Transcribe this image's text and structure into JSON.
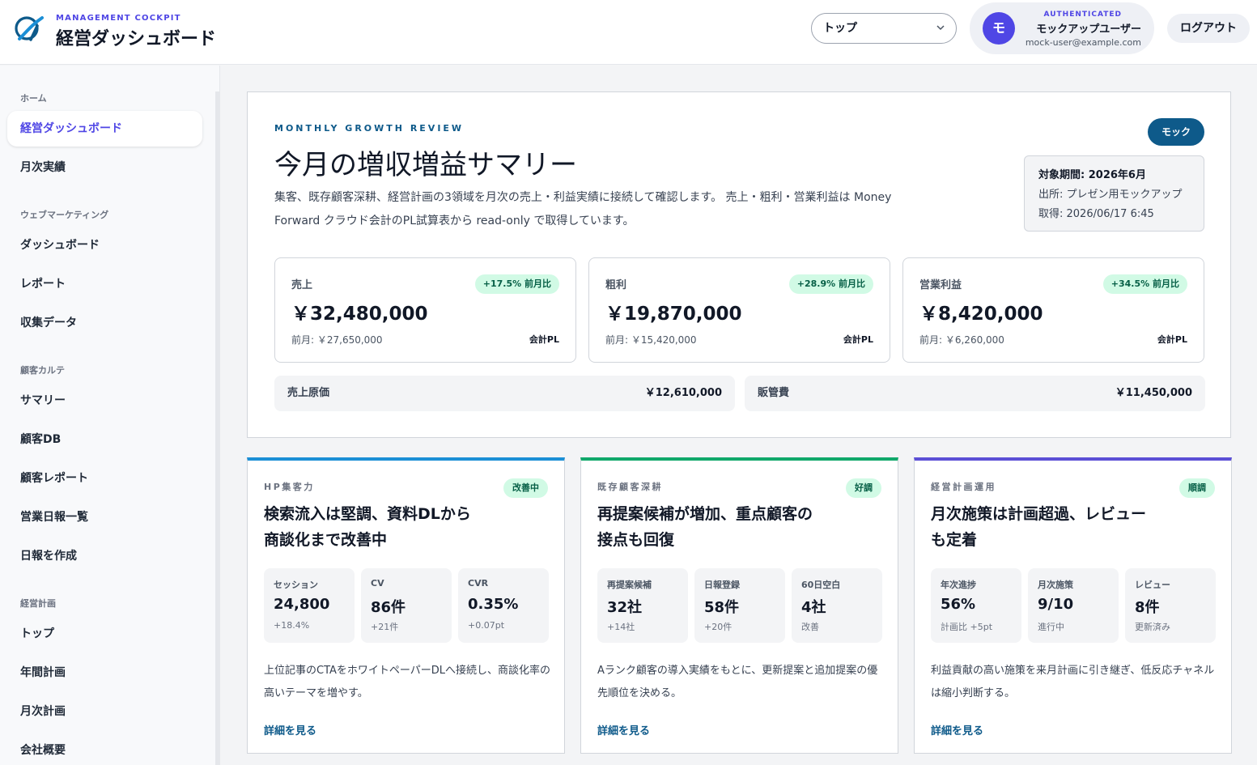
{
  "header": {
    "brand_sub": "MANAGEMENT COCKPIT",
    "brand_title": "経営ダッシュボード",
    "page_select": {
      "value": "トップ"
    },
    "user": {
      "auth_label": "AUTHENTICATED",
      "avatar_initial": "モ",
      "name": "モックアップユーザー",
      "email": "mock-user@example.com"
    },
    "logout_label": "ログアウト",
    "colors": {
      "accent": "#4f46e5",
      "brand_blue": "#0e5a8a"
    }
  },
  "sidebar": {
    "groups": [
      {
        "label": "ホーム",
        "items": [
          {
            "label": "経営ダッシュボード",
            "active": true
          },
          {
            "label": "月次実績"
          }
        ]
      },
      {
        "label": "ウェブマーケティング",
        "items": [
          {
            "label": "ダッシュボード"
          },
          {
            "label": "レポート"
          },
          {
            "label": "収集データ"
          }
        ]
      },
      {
        "label": "顧客カルテ",
        "items": [
          {
            "label": "サマリー"
          },
          {
            "label": "顧客DB"
          },
          {
            "label": "顧客レポート"
          },
          {
            "label": "営業日報一覧"
          },
          {
            "label": "日報を作成"
          }
        ]
      },
      {
        "label": "経営計画",
        "items": [
          {
            "label": "トップ"
          },
          {
            "label": "年間計画"
          },
          {
            "label": "月次計画"
          },
          {
            "label": "会社概要"
          }
        ]
      }
    ]
  },
  "summary": {
    "eyebrow": "MONTHLY GROWTH REVIEW",
    "title": "今月の増収増益サマリー",
    "description": "集客、既存顧客深耕、経営計画の3領域を月次の売上・利益実績に接続して確認します。 売上・粗利・営業利益は Money Forward クラウド会計のPL試算表から read-only で取得しています。",
    "mock_badge": "モック",
    "meta": {
      "period": "対象期間: 2026年6月",
      "source": "出所: プレゼン用モックアップ",
      "fetched": "取得: 2026/06/17 6:45"
    },
    "kpis": [
      {
        "label": "売上",
        "badge": "+17.5% 前月比",
        "value": "￥32,480,000",
        "prev": "前月: ￥27,650,000",
        "source": "会計PL"
      },
      {
        "label": "粗利",
        "badge": "+28.9% 前月比",
        "value": "￥19,870,000",
        "prev": "前月: ￥15,420,000",
        "source": "会計PL"
      },
      {
        "label": "営業利益",
        "badge": "+34.5% 前月比",
        "value": "￥8,420,000",
        "prev": "前月: ￥6,260,000",
        "source": "会計PL"
      }
    ],
    "costs": [
      {
        "label": "売上原価",
        "value": "￥12,610,000"
      },
      {
        "label": "販管費",
        "value": "￥11,450,000"
      }
    ]
  },
  "cards": [
    {
      "eyebrow": "HP集客力",
      "badge": "改善中",
      "accent": "#1b8fd6",
      "title_lines": [
        "検索流入は堅調、資料DLから",
        "商談化まで改善中"
      ],
      "metrics": [
        {
          "label": "セッション",
          "value": "24,800",
          "note": "+18.4%"
        },
        {
          "label": "CV",
          "value": "86件",
          "note": "+21件"
        },
        {
          "label": "CVR",
          "value": "0.35%",
          "note": "+0.07pt"
        }
      ],
      "text": "上位記事のCTAをホワイトペーパーDLへ接続し、商談化率の高いテーマを増やす。",
      "link": "詳細を見る"
    },
    {
      "eyebrow": "既存顧客深耕",
      "badge": "好調",
      "accent": "#10a86b",
      "title_lines": [
        "再提案候補が増加、重点顧客の",
        "接点も回復"
      ],
      "metrics": [
        {
          "label": "再提案候補",
          "value": "32社",
          "note": "+14社"
        },
        {
          "label": "日報登録",
          "value": "58件",
          "note": "+20件"
        },
        {
          "label": "60日空白",
          "value": "4社",
          "note": "改善"
        }
      ],
      "text": "Aランク顧客の導入実績をもとに、更新提案と追加提案の優先順位を決める。",
      "link": "詳細を見る"
    },
    {
      "eyebrow": "経営計画運用",
      "badge": "順調",
      "accent": "#5b4fd6",
      "title_lines": [
        "月次施策は計画超過、レビュー",
        "も定着"
      ],
      "metrics": [
        {
          "label": "年次進捗",
          "value": "56%",
          "note": "計画比 +5pt"
        },
        {
          "label": "月次施策",
          "value": "9/10",
          "note": "進行中"
        },
        {
          "label": "レビュー",
          "value": "8件",
          "note": "更新済み"
        }
      ],
      "text": "利益貢献の高い施策を来月計画に引き継ぎ、低反応チャネルは縮小判断する。",
      "link": "詳細を見る"
    }
  ]
}
